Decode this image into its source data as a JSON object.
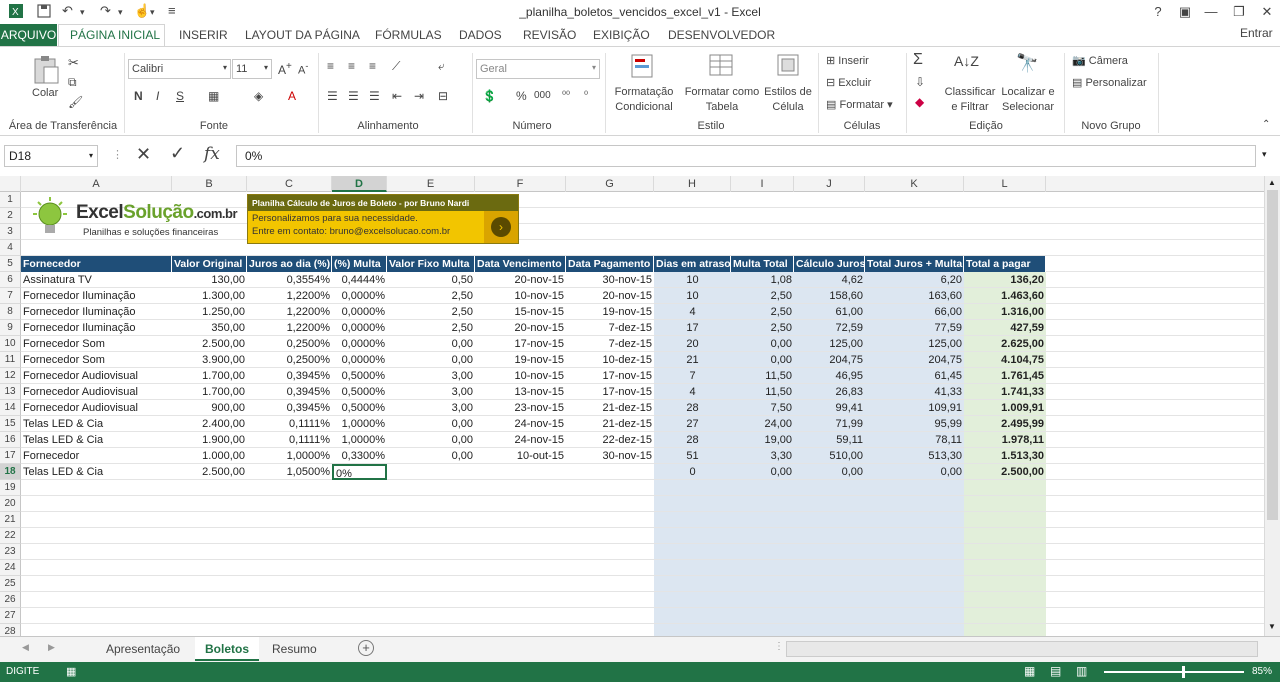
{
  "window": {
    "title": "_planilha_boletos_vencidos_excel_v1 - Excel",
    "help": "?",
    "signin": "Entrar"
  },
  "ribbon_tabs": [
    "ARQUIVO",
    "PÁGINA INICIAL",
    "INSERIR",
    "LAYOUT DA PÁGINA",
    "FÓRMULAS",
    "DADOS",
    "REVISÃO",
    "EXIBIÇÃO",
    "DESENVOLVEDOR"
  ],
  "clipboard": {
    "paste": "Colar",
    "label": "Área de Transferência"
  },
  "font": {
    "name": "Calibri",
    "size": "11",
    "bold": "N",
    "italic": "I",
    "underline": "S",
    "label": "Fonte"
  },
  "alignment": {
    "label": "Alinhamento"
  },
  "number": {
    "format": "Geral",
    "pct": "%",
    "thousands": "000",
    "label": "Número"
  },
  "styles": {
    "cond": "Formatação",
    "cond2": "Condicional",
    "table": "Formatar como",
    "table2": "Tabela",
    "cell": "Estilos de",
    "cell2": "Célula",
    "label": "Estilo"
  },
  "cells": {
    "insert": "Inserir",
    "delete": "Excluir",
    "format": "Formatar",
    "label": "Células"
  },
  "editing": {
    "sort": "Classificar",
    "sort2": "e Filtrar",
    "find": "Localizar e",
    "find2": "Selecionar",
    "label": "Edição"
  },
  "newgroup": {
    "camera": "Câmera",
    "custom": "Personalizar",
    "label": "Novo Grupo"
  },
  "formula_bar": {
    "name_box": "D18",
    "fx": "fx",
    "value": "0%"
  },
  "columns": [
    "A",
    "B",
    "C",
    "D",
    "E",
    "F",
    "G",
    "H",
    "I",
    "J",
    "K",
    "L"
  ],
  "logo": {
    "brand1": "Excel",
    "brand2": "Solução",
    "brand3": ".com.br",
    "tagline": "Planilhas e soluções financeiras"
  },
  "banner": {
    "title": "Planilha Cálculo de Juros de Boleto - por Bruno Nardi",
    "line1": "Personalizamos para sua necessidade.",
    "line2": "Entre em contato: bruno@excelsolucao.com.br"
  },
  "table_headers": [
    "Fornecedor",
    "Valor Original",
    "Juros ao dia (%)",
    "(%) Multa",
    "Valor Fixo Multa",
    "Data Vencimento",
    "Data Pagamento",
    "Dias em atraso",
    "Multa Total",
    "Cálculo Juros",
    "Total Juros + Multa",
    "Total a pagar"
  ],
  "rows": [
    [
      "Assinatura TV",
      "130,00",
      "0,3554%",
      "0,4444%",
      "0,50",
      "20-nov-15",
      "30-nov-15",
      "10",
      "1,08",
      "4,62",
      "6,20",
      "136,20"
    ],
    [
      "Fornecedor Iluminação",
      "1.300,00",
      "1,2200%",
      "0,0000%",
      "2,50",
      "10-nov-15",
      "20-nov-15",
      "10",
      "2,50",
      "158,60",
      "163,60",
      "1.463,60"
    ],
    [
      "Fornecedor Iluminação",
      "1.250,00",
      "1,2200%",
      "0,0000%",
      "2,50",
      "15-nov-15",
      "19-nov-15",
      "4",
      "2,50",
      "61,00",
      "66,00",
      "1.316,00"
    ],
    [
      "Fornecedor Iluminação",
      "350,00",
      "1,2200%",
      "0,0000%",
      "2,50",
      "20-nov-15",
      "7-dez-15",
      "17",
      "2,50",
      "72,59",
      "77,59",
      "427,59"
    ],
    [
      "Fornecedor Som",
      "2.500,00",
      "0,2500%",
      "0,0000%",
      "0,00",
      "17-nov-15",
      "7-dez-15",
      "20",
      "0,00",
      "125,00",
      "125,00",
      "2.625,00"
    ],
    [
      "Fornecedor Som",
      "3.900,00",
      "0,2500%",
      "0,0000%",
      "0,00",
      "19-nov-15",
      "10-dez-15",
      "21",
      "0,00",
      "204,75",
      "204,75",
      "4.104,75"
    ],
    [
      "Fornecedor Audiovisual",
      "1.700,00",
      "0,3945%",
      "0,5000%",
      "3,00",
      "10-nov-15",
      "17-nov-15",
      "7",
      "11,50",
      "46,95",
      "61,45",
      "1.761,45"
    ],
    [
      "Fornecedor Audiovisual",
      "1.700,00",
      "0,3945%",
      "0,5000%",
      "3,00",
      "13-nov-15",
      "17-nov-15",
      "4",
      "11,50",
      "26,83",
      "41,33",
      "1.741,33"
    ],
    [
      "Fornecedor Audiovisual",
      "900,00",
      "0,3945%",
      "0,5000%",
      "3,00",
      "23-nov-15",
      "21-dez-15",
      "28",
      "7,50",
      "99,41",
      "109,91",
      "1.009,91"
    ],
    [
      "Telas LED & Cia",
      "2.400,00",
      "0,1111%",
      "1,0000%",
      "0,00",
      "24-nov-15",
      "21-dez-15",
      "27",
      "24,00",
      "71,99",
      "95,99",
      "2.495,99"
    ],
    [
      "Telas LED & Cia",
      "1.900,00",
      "0,1111%",
      "1,0000%",
      "0,00",
      "24-nov-15",
      "22-dez-15",
      "28",
      "19,00",
      "59,11",
      "78,11",
      "1.978,11"
    ],
    [
      "Fornecedor",
      "1.000,00",
      "1,0000%",
      "0,3300%",
      "0,00",
      "10-out-15",
      "30-nov-15",
      "51",
      "3,30",
      "510,00",
      "513,30",
      "1.513,30"
    ],
    [
      "Telas LED & Cia",
      "2.500,00",
      "1,0500%",
      "0%",
      "",
      "",
      "",
      "0",
      "0,00",
      "0,00",
      "0,00",
      "2.500,00"
    ]
  ],
  "row_numbers": [
    "1",
    "2",
    "3",
    "4",
    "5",
    "6",
    "7",
    "8",
    "9",
    "10",
    "11",
    "12",
    "13",
    "14",
    "15",
    "16",
    "17",
    "18",
    "19",
    "20",
    "21",
    "22",
    "23",
    "24",
    "25",
    "26",
    "27",
    "28"
  ],
  "sheets": [
    "Apresentação",
    "Boletos",
    "Resumo"
  ],
  "status": {
    "mode": "DIGITE",
    "zoom": "85%"
  },
  "colors": {
    "excel_green": "#217346",
    "header_blue": "#1f4e78",
    "shade_blue": "#dce6f1",
    "shade_green": "#e2efda"
  }
}
